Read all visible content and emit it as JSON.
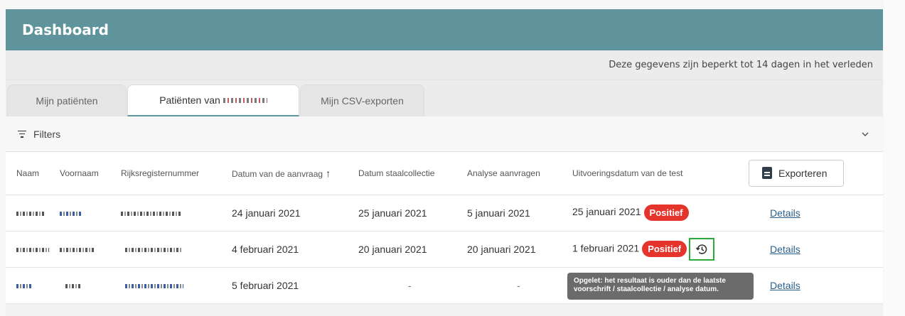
{
  "header": {
    "title": "Dashboard"
  },
  "notice": "Deze gegevens zijn beperkt tot 14 dagen in het verleden",
  "tabs": [
    {
      "label": "Mijn patiënten"
    },
    {
      "label": "Patiënten van"
    },
    {
      "label": "Mijn CSV-exporten"
    }
  ],
  "filters": {
    "label": "Filters"
  },
  "table": {
    "columns": [
      "Naam",
      "Voornaam",
      "Rijksregisternummer",
      "Datum van de aanvraag",
      "Datum staalcollectie",
      "Analyse aanvragen",
      "Uitvoeringsdatum van de test"
    ],
    "export_label": "Exporteren",
    "rows": [
      {
        "aanvraag": "24 januari 2021",
        "staal": "25 januari 2021",
        "analyse": "5 januari 2021",
        "uitvoering": "25 januari 2021",
        "badge": "Positief",
        "details": "Details"
      },
      {
        "aanvraag": "4 februari 2021",
        "staal": "20 januari 2021",
        "analyse": "20 januari 2021",
        "uitvoering": "1 februari 2021",
        "badge": "Positief",
        "details": "Details"
      },
      {
        "aanvraag": "5 februari 2021",
        "staal": "-",
        "analyse": "-",
        "details": "Details"
      }
    ]
  },
  "tooltip": {
    "line1": "Opgelet: het resultaat is ouder dan de laatste",
    "line2": "voorschrift / staalcollectie / analyse datum."
  },
  "colors": {
    "header": "#5f949c",
    "badge": "#e4342b",
    "highlight": "#2daa3a"
  }
}
